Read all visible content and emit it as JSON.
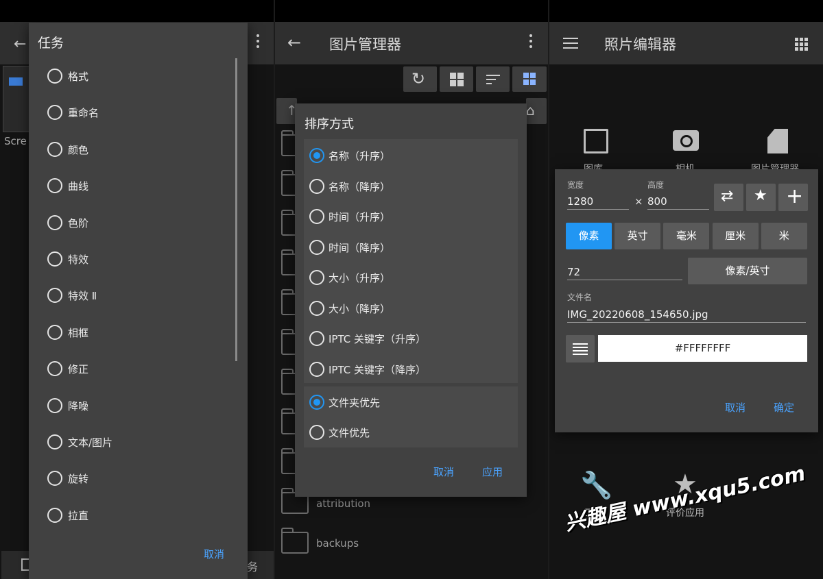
{
  "left": {
    "dialog_title": "任务",
    "background_fragment": "Scre",
    "bottom_fragment": "务",
    "items": [
      "格式",
      "重命名",
      "颜色",
      "曲线",
      "色阶",
      "特效",
      "特效 Ⅱ",
      "相框",
      "修正",
      "降噪",
      "文本/图片",
      "旋转",
      "拉直"
    ],
    "cancel_label": "取消"
  },
  "middle": {
    "title": "图片管理器",
    "sort_dialog": {
      "title": "排序方式",
      "options": [
        "名称（升序）",
        "名称（降序）",
        "时间（升序）",
        "时间（降序）",
        "大小（升序）",
        "大小（降序）",
        "IPTC 关键字（升序）",
        "IPTC 关键字（降序）"
      ],
      "selected_index": 0,
      "folder_options": [
        "文件夹优先",
        "文件优先"
      ],
      "folder_selected_index": 0,
      "cancel_label": "取消",
      "apply_label": "应用"
    },
    "folders": [
      "attribution",
      "backups"
    ]
  },
  "right": {
    "title": "照片编辑器",
    "bg_items": [
      "图库",
      "相机",
      "图片管理器",
      "工具",
      "评价应用"
    ],
    "resize_dialog": {
      "width_label": "宽度",
      "width_value": "1280",
      "times_symbol": "×",
      "height_label": "高度",
      "height_value": "800",
      "units": [
        "像素",
        "英寸",
        "毫米",
        "厘米",
        "米"
      ],
      "selected_unit_index": 0,
      "dpi_value": "72",
      "dpi_unit": "像素/英寸",
      "filename_label": "文件名",
      "filename_value": "IMG_20220608_154650.jpg",
      "color_value": "#FFFFFFFF",
      "cancel_label": "取消",
      "ok_label": "确定"
    },
    "watermark": "兴趣屋 www.xqu5.com"
  },
  "colors": {
    "accent": "#2196f3",
    "dialog": "#414141",
    "appbar": "#2f2f2f"
  }
}
